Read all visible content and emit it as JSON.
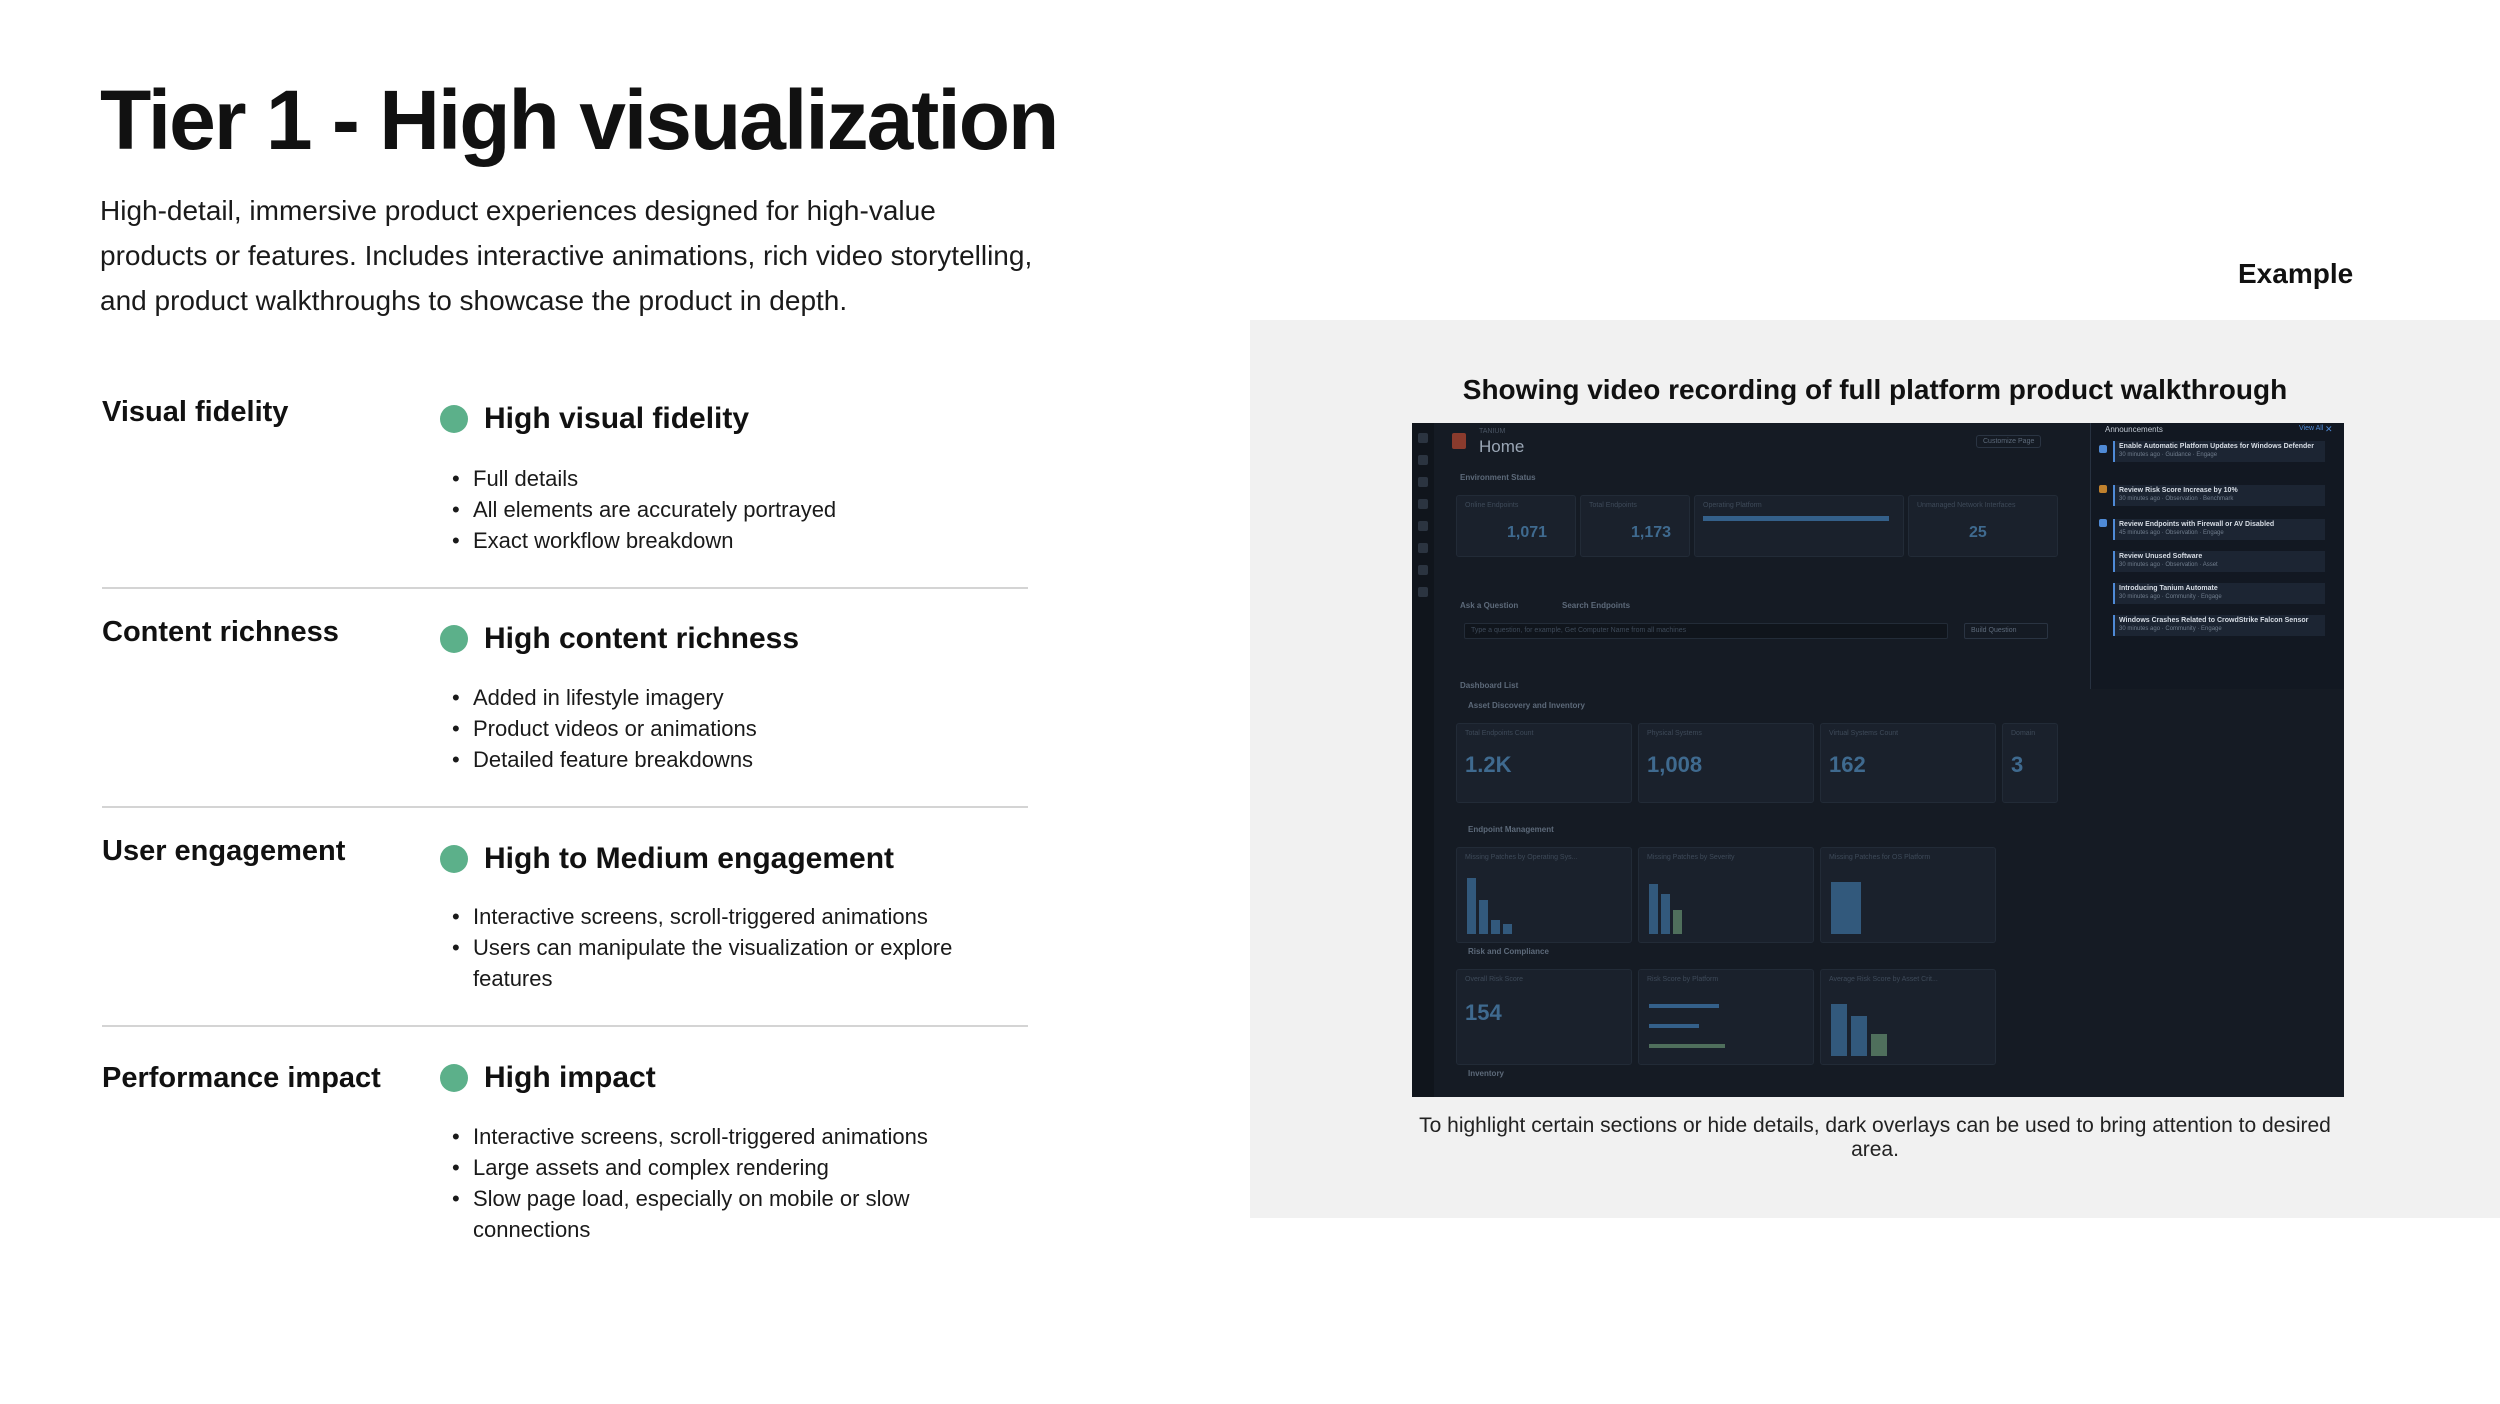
{
  "title": "Tier 1 -  High visualization",
  "intro": "High-detail, immersive product experiences designed for high-value products or features. Includes interactive animations, rich video storytelling, and product walkthroughs to showcase the product in depth.",
  "rows": [
    {
      "label": "Visual  fidelity",
      "level": "High visual fidelity",
      "bullets": [
        "Full details",
        "All elements are accurately portrayed",
        "Exact workflow breakdown"
      ]
    },
    {
      "label": "Content richness",
      "level": "High content richness",
      "bullets": [
        "Added in lifestyle imagery",
        "Product videos or animations",
        "Detailed feature breakdowns"
      ]
    },
    {
      "label": "User engagement",
      "level": "High to Medium engagement",
      "bullets": [
        "Interactive screens, scroll-triggered animations",
        "Users can manipulate the visualization or explore features"
      ]
    },
    {
      "label": "Performance impact",
      "level": "High impact",
      "bullets": [
        "Interactive screens, scroll-triggered animations",
        "Large assets and complex rendering",
        "Slow page load, especially on mobile or slow connections"
      ]
    }
  ],
  "colors": {
    "indicator": "#5cb08a",
    "panel": "#f1f1f1",
    "screen": "#151b24"
  },
  "example": {
    "label": "Example",
    "heading": "Showing  video recording of full platform product walkthrough",
    "caption": "To highlight certain sections or hide details, dark overlays can be used to bring attention to desired area.",
    "screenshot": {
      "brand": "TANIUM",
      "page": "Home",
      "customize": "Customize Page",
      "env_status": "Environment Status",
      "stats": [
        {
          "label": "Online Endpoints",
          "value": "1,071"
        },
        {
          "label": "Total Endpoints",
          "value": "1,173"
        },
        {
          "label": "Operating Platform",
          "value": ""
        },
        {
          "label": "Unmanaged Network Interfaces",
          "value": "25"
        }
      ],
      "ask": "Ask a Question",
      "search": "Search Endpoints",
      "ask_placeholder": "Type a question, for example, Get Computer Name from all machines",
      "build": "Build Question",
      "dashboard_list": "Dashboard List",
      "asset_section": "Asset Discovery and Inventory",
      "assets": [
        {
          "label": "Total Endpoints Count",
          "value": "1.2K"
        },
        {
          "label": "Physical Systems",
          "value": "1,008"
        },
        {
          "label": "Virtual Systems Count",
          "value": "162"
        },
        {
          "label": "Domain",
          "value": "3"
        }
      ],
      "endpoint_section": "Endpoint Management",
      "patches": [
        "Missing Patches by Operating Sys...",
        "Missing Patches by Severity",
        "Missing Patches for OS Platform"
      ],
      "risk_section": "Risk and Compliance",
      "risk": [
        {
          "label": "Overall Risk Score",
          "value": "154"
        },
        {
          "label": "Risk Score by Platform",
          "value": ""
        },
        {
          "label": "Average Risk Score by Asset Crit...",
          "value": ""
        }
      ],
      "inventory": "Inventory",
      "announcements_title": "Announcements",
      "view_all": "View All",
      "announcements": [
        {
          "title": "Enable Automatic Platform Updates for Windows Defender",
          "meta": "30 minutes ago · Guidance · Engage"
        },
        {
          "title": "Review Risk Score Increase by 10%",
          "meta": "30 minutes ago · Observation · Benchmark"
        },
        {
          "title": "Review Endpoints with Firewall or AV Disabled",
          "meta": "45 minutes ago · Observation · Engage"
        },
        {
          "title": "Review Unused Software",
          "meta": "30 minutes ago · Observation · Asset"
        },
        {
          "title": "Introducing Tanium Automate",
          "meta": "30 minutes ago · Community · Engage"
        },
        {
          "title": "Windows Crashes Related to CrowdStrike Falcon Sensor",
          "meta": "30 minutes ago · Community · Engage"
        }
      ]
    }
  }
}
